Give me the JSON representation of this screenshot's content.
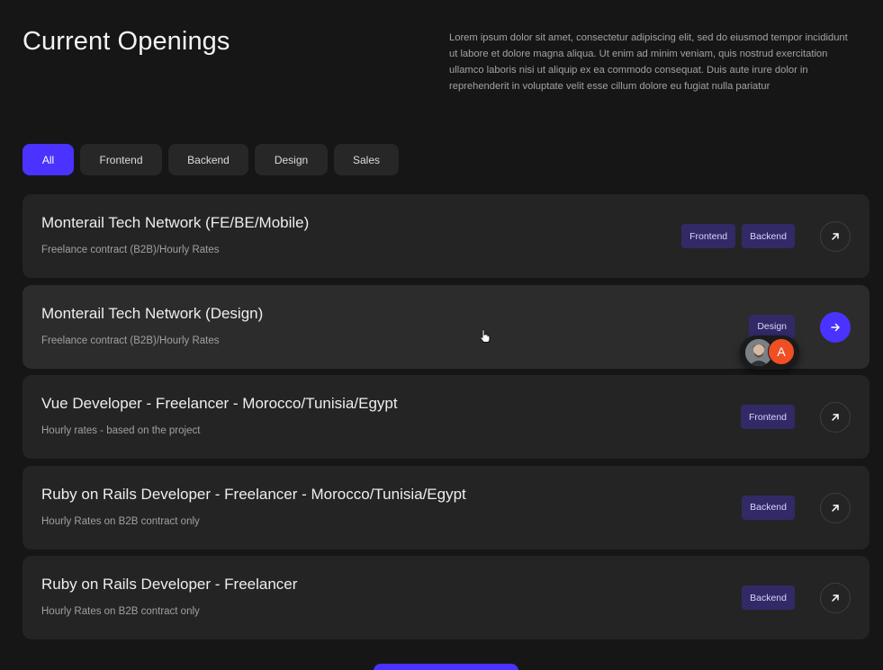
{
  "header": {
    "title": "Current Openings",
    "intro": "Lorem ipsum dolor sit amet, consectetur adipiscing elit, sed do eiusmod tempor incididunt ut labore et dolore magna aliqua. Ut enim ad minim veniam, quis nostrud exercitation ullamco laboris nisi ut aliquip ex ea commodo consequat. Duis aute irure dolor in reprehenderit in voluptate velit esse cillum dolore eu fugiat nulla pariatur"
  },
  "filters": [
    {
      "label": "All",
      "active": true
    },
    {
      "label": "Frontend",
      "active": false
    },
    {
      "label": "Backend",
      "active": false
    },
    {
      "label": "Design",
      "active": false
    },
    {
      "label": "Sales",
      "active": false
    }
  ],
  "jobs": [
    {
      "title": "Monterail Tech Network (FE/BE/Mobile)",
      "subtitle": "Freelance contract (B2B)/Hourly Rates",
      "tags": [
        "Frontend",
        "Backend"
      ],
      "hovered": false
    },
    {
      "title": "Monterail Tech Network (Design)",
      "subtitle": "Freelance contract (B2B)/Hourly Rates",
      "tags": [
        "Design"
      ],
      "hovered": true,
      "avatar_letter": "A"
    },
    {
      "title": "Vue Developer - Freelancer - Morocco/Tunisia/Egypt",
      "subtitle": "Hourly rates - based on the project",
      "tags": [
        "Frontend"
      ],
      "hovered": false
    },
    {
      "title": "Ruby on Rails Developer - Freelancer - Morocco/Tunisia/Egypt",
      "subtitle": "Hourly Rates on B2B contract only",
      "tags": [
        "Backend"
      ],
      "hovered": false
    },
    {
      "title": "Ruby on Rails Developer - Freelancer",
      "subtitle": "Hourly Rates on B2B contract only",
      "tags": [
        "Backend"
      ],
      "hovered": false
    }
  ],
  "icons": {
    "arrow_default": "arrow-up-right-icon",
    "arrow_hover": "arrow-right-icon",
    "cursor": "hand-pointer-icon"
  },
  "colors": {
    "accent": "#4a32ff",
    "background": "#161616",
    "card": "#242424",
    "tag": "#322a66",
    "avatar_letter_bg": "#f04e23"
  }
}
